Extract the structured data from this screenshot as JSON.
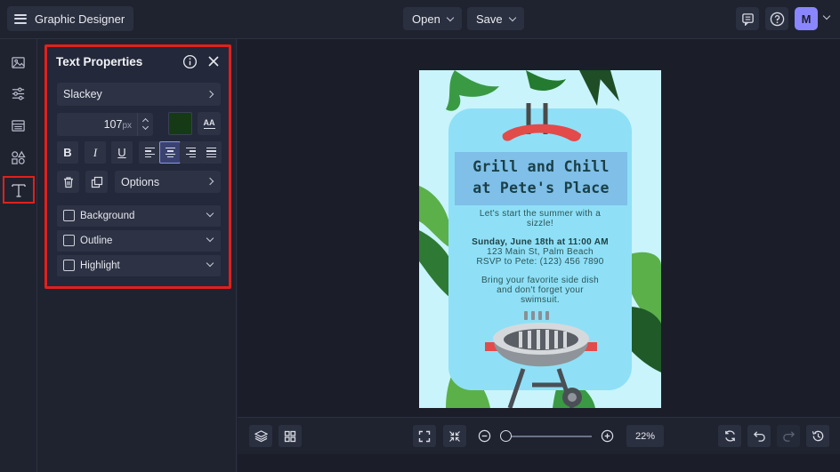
{
  "app": {
    "title": "Graphic Designer",
    "open_label": "Open",
    "save_label": "Save",
    "avatar_initial": "M"
  },
  "panel": {
    "title": "Text Properties",
    "font_name": "Slackey",
    "font_size": "107",
    "font_unit": "px",
    "text_color": "#163a16",
    "effect_glyph": "AA",
    "bold_label": "B",
    "italic_label": "I",
    "underline_label": "U",
    "options_label": "Options",
    "accordions": [
      {
        "label": "Background",
        "checked": false
      },
      {
        "label": "Outline",
        "checked": false
      },
      {
        "label": "Highlight",
        "checked": false
      }
    ]
  },
  "poster": {
    "headline": [
      "Grill and Chill",
      "at Pete's Place"
    ],
    "intro": [
      "Let's start the summer with a",
      "sizzle!"
    ],
    "date": "Sunday, June 18th at 11:00 AM",
    "address": "123 Main St, Palm Beach",
    "rsvp": "RSVP to Pete: (123) 456 7890",
    "closing": [
      "Bring your favorite side dish",
      "and don't forget your",
      "swimsuit."
    ]
  },
  "zoom": {
    "level": "22%",
    "fraction": 0.0
  },
  "colors": {
    "accent": "#8a86ff",
    "highlight_red": "#e0201e"
  }
}
